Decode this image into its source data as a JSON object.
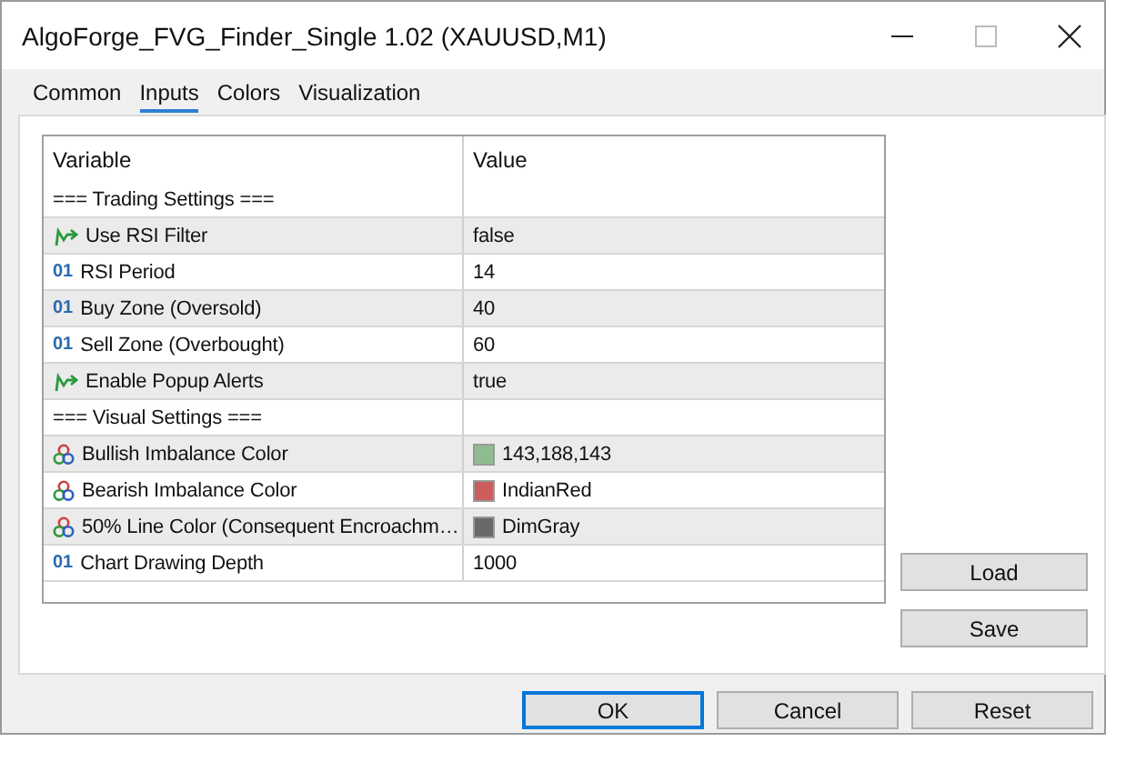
{
  "window": {
    "title": "AlgoForge_FVG_Finder_Single 1.02 (XAUUSD,M1)"
  },
  "tabs": [
    {
      "label": "Common",
      "selected": false
    },
    {
      "label": "Inputs",
      "selected": true
    },
    {
      "label": "Colors",
      "selected": false
    },
    {
      "label": "Visualization",
      "selected": false
    }
  ],
  "table": {
    "columns": [
      "Variable",
      "Value"
    ],
    "rows": [
      {
        "kind": "section",
        "variable": "=== Trading Settings ==="
      },
      {
        "kind": "bool",
        "variable": "Use RSI Filter",
        "value": "false"
      },
      {
        "kind": "int",
        "icon_text": "01",
        "variable": "RSI Period",
        "value": "14"
      },
      {
        "kind": "int",
        "icon_text": "01",
        "variable": "Buy Zone (Oversold)",
        "value": "40"
      },
      {
        "kind": "int",
        "icon_text": "01",
        "variable": "Sell Zone (Overbought)",
        "value": "60"
      },
      {
        "kind": "bool",
        "variable": "Enable Popup Alerts",
        "value": "true"
      },
      {
        "kind": "section",
        "variable": "=== Visual Settings ==="
      },
      {
        "kind": "color",
        "variable": "Bullish Imbalance Color",
        "value": "143,188,143",
        "color": "#8fbc8f"
      },
      {
        "kind": "color",
        "variable": "Bearish Imbalance Color",
        "value": "IndianRed",
        "color": "#cd5c5c"
      },
      {
        "kind": "color",
        "variable": "50% Line Color (Consequent Encroachm…",
        "value": "DimGray",
        "color": "#696969"
      },
      {
        "kind": "int",
        "icon_text": "01",
        "variable": "Chart Drawing Depth",
        "value": "1000"
      }
    ]
  },
  "side_buttons": [
    "Load",
    "Save"
  ],
  "buttons": [
    {
      "label": "OK",
      "default": true
    },
    {
      "label": "Cancel",
      "default": false
    },
    {
      "label": "Reset",
      "default": false
    }
  ]
}
